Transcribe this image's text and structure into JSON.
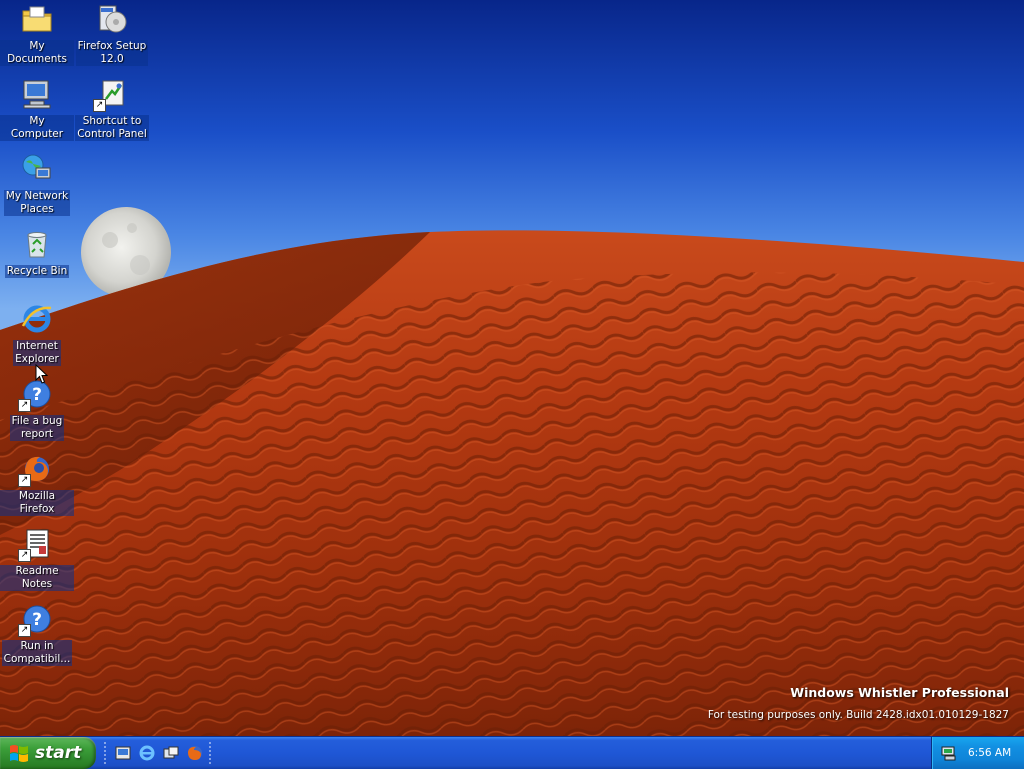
{
  "desktop": {
    "icons": [
      {
        "label": "My Documents",
        "icon": "folder-icon"
      },
      {
        "label": "Firefox Setup\n12.0",
        "icon": "installer-icon"
      },
      {
        "label": "My Computer",
        "icon": "computer-icon"
      },
      {
        "label": "Shortcut to\nControl Panel",
        "icon": "control-panel-icon"
      },
      {
        "label": "My Network\nPlaces",
        "icon": "network-icon"
      },
      {
        "label": "Recycle Bin",
        "icon": "recycle-bin-icon"
      },
      {
        "label": "Internet\nExplorer",
        "icon": "internet-explorer-icon"
      },
      {
        "label": "File a bug\nreport",
        "icon": "help-icon"
      },
      {
        "label": "Mozilla Firefox",
        "icon": "firefox-icon"
      },
      {
        "label": "Readme Notes",
        "icon": "notes-icon"
      },
      {
        "label": "Run in\nCompatibil...",
        "icon": "help-icon"
      }
    ],
    "branding": {
      "title": "Windows Whistler Professional",
      "build": "For testing purposes only. Build 2428.idx01.010129-1827"
    }
  },
  "taskbar": {
    "start_label": "start",
    "quick_launch": [
      "show-desktop-icon",
      "internet-explorer-icon",
      "media-icon",
      "firefox-icon"
    ],
    "clock": "6:56 AM"
  },
  "colors": {
    "sky": "#1a4fc8",
    "dune": "#b83a12",
    "taskbar": "#245edb",
    "start_button": "#3c9f3a",
    "tray": "#0f84d8"
  }
}
